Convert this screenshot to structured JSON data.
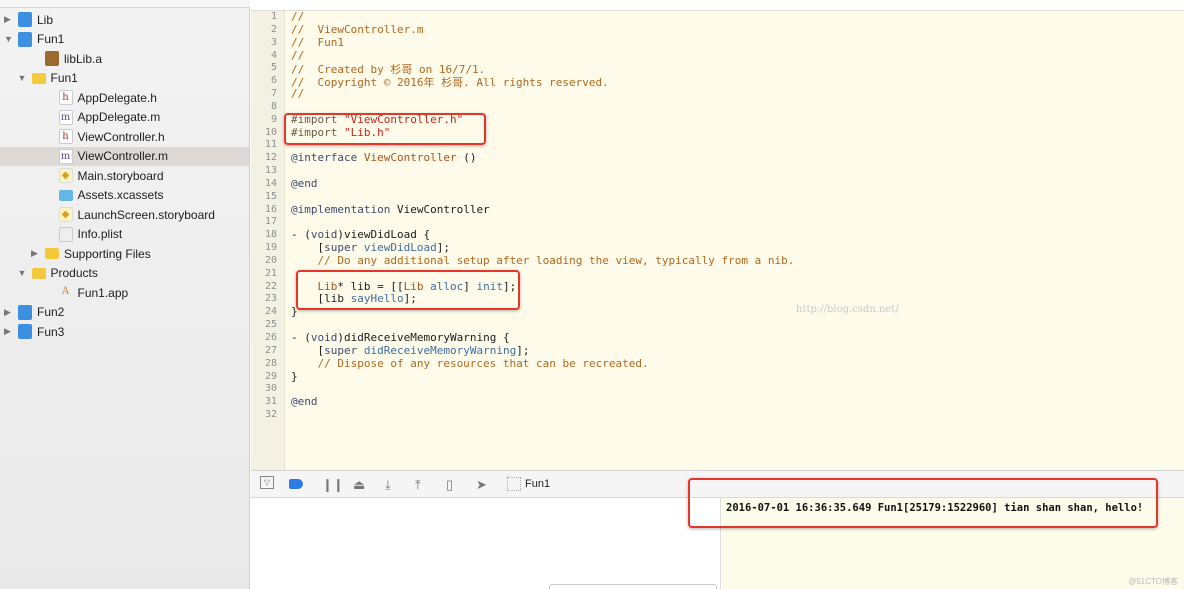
{
  "navigator": {
    "items": [
      {
        "label": "Lib",
        "icon": "project-icon",
        "indent": 0,
        "disclosure": "collapsed"
      },
      {
        "label": "Fun1",
        "icon": "project-icon",
        "indent": 0,
        "disclosure": "expanded"
      },
      {
        "label": "libLib.a",
        "icon": "library-icon",
        "indent": 2,
        "disclosure": ""
      },
      {
        "label": "Fun1",
        "icon": "folder-icon",
        "indent": 1,
        "disclosure": "expanded"
      },
      {
        "label": "AppDelegate.h",
        "icon": "header-file-icon",
        "indent": 3,
        "disclosure": ""
      },
      {
        "label": "AppDelegate.m",
        "icon": "objc-file-icon",
        "indent": 3,
        "disclosure": ""
      },
      {
        "label": "ViewController.h",
        "icon": "header-file-icon",
        "indent": 3,
        "disclosure": ""
      },
      {
        "label": "ViewController.m",
        "icon": "objc-file-icon",
        "indent": 3,
        "disclosure": "",
        "selected": true
      },
      {
        "label": "Main.storyboard",
        "icon": "storyboard-icon",
        "indent": 3,
        "disclosure": ""
      },
      {
        "label": "Assets.xcassets",
        "icon": "assets-folder-icon",
        "indent": 3,
        "disclosure": ""
      },
      {
        "label": "LaunchScreen.storyboard",
        "icon": "storyboard-icon",
        "indent": 3,
        "disclosure": ""
      },
      {
        "label": "Info.plist",
        "icon": "plist-icon",
        "indent": 3,
        "disclosure": ""
      },
      {
        "label": "Supporting Files",
        "icon": "folder-icon",
        "indent": 2,
        "disclosure": "collapsed"
      },
      {
        "label": "Products",
        "icon": "folder-icon",
        "indent": 1,
        "disclosure": "expanded"
      },
      {
        "label": "Fun1.app",
        "icon": "app-icon",
        "indent": 3,
        "disclosure": ""
      },
      {
        "label": "Fun2",
        "icon": "project-icon",
        "indent": 0,
        "disclosure": "collapsed"
      },
      {
        "label": "Fun3",
        "icon": "project-icon",
        "indent": 0,
        "disclosure": "collapsed"
      }
    ]
  },
  "editor": {
    "lines": [
      [
        [
          "c",
          "//"
        ]
      ],
      [
        [
          "c",
          "//  ViewController.m"
        ]
      ],
      [
        [
          "c",
          "//  Fun1"
        ]
      ],
      [
        [
          "c",
          "//"
        ]
      ],
      [
        [
          "c",
          "//  Created by 杉哥 on 16/7/1."
        ]
      ],
      [
        [
          "c",
          "//  Copyright © 2016年 杉哥. All rights reserved."
        ]
      ],
      [
        [
          "c",
          "//"
        ]
      ],
      [],
      [
        [
          "pp",
          "#import "
        ],
        [
          "s",
          "\"ViewController.h\""
        ]
      ],
      [
        [
          "pp",
          "#import "
        ],
        [
          "s",
          "\"Lib.h\""
        ]
      ],
      [],
      [
        [
          "k",
          "@interface "
        ],
        [
          "t",
          "ViewController"
        ],
        [
          "p",
          " ()"
        ]
      ],
      [],
      [
        [
          "k",
          "@end"
        ]
      ],
      [],
      [
        [
          "k",
          "@implementation "
        ],
        [
          "p",
          "ViewController"
        ]
      ],
      [],
      [
        [
          "p",
          "- ("
        ],
        [
          "k",
          "void"
        ],
        [
          "p",
          ")viewDidLoad {"
        ]
      ],
      [
        [
          "p",
          "    ["
        ],
        [
          "k",
          "super "
        ],
        [
          "m",
          "viewDidLoad"
        ],
        [
          "p",
          "];"
        ]
      ],
      [
        [
          "c",
          "    // Do any additional setup after loading the view, typically from a nib."
        ]
      ],
      [],
      [
        [
          "t",
          "    Lib"
        ],
        [
          "p",
          "* lib = [["
        ],
        [
          "t",
          "Lib "
        ],
        [
          "m",
          "alloc"
        ],
        [
          "p",
          "] "
        ],
        [
          "m",
          "init"
        ],
        [
          "p",
          "];"
        ]
      ],
      [
        [
          "p",
          "    [lib "
        ],
        [
          "m",
          "sayHello"
        ],
        [
          "p",
          "];"
        ]
      ],
      [
        [
          "p",
          "}"
        ]
      ],
      [],
      [
        [
          "p",
          "- ("
        ],
        [
          "k",
          "void"
        ],
        [
          "p",
          ")didReceiveMemoryWarning {"
        ]
      ],
      [
        [
          "p",
          "    ["
        ],
        [
          "k",
          "super "
        ],
        [
          "m",
          "didReceiveMemoryWarning"
        ],
        [
          "p",
          "];"
        ]
      ],
      [
        [
          "c",
          "    // Dispose of any resources that can be recreated."
        ]
      ],
      [
        [
          "p",
          "}"
        ]
      ],
      [],
      [
        [
          "k",
          "@end"
        ]
      ],
      []
    ],
    "watermark": "http://blog.csdn.net/"
  },
  "debug_bar": {
    "target": "Fun1"
  },
  "console": {
    "log": "2016-07-01 16:36:35.649 Fun1[25179:1522960] tian shan shan, hello!",
    "watermark": "@51CTO博客"
  },
  "colors": {
    "highlight_box": "#e3362c",
    "editor_bg": "#fefbea"
  }
}
